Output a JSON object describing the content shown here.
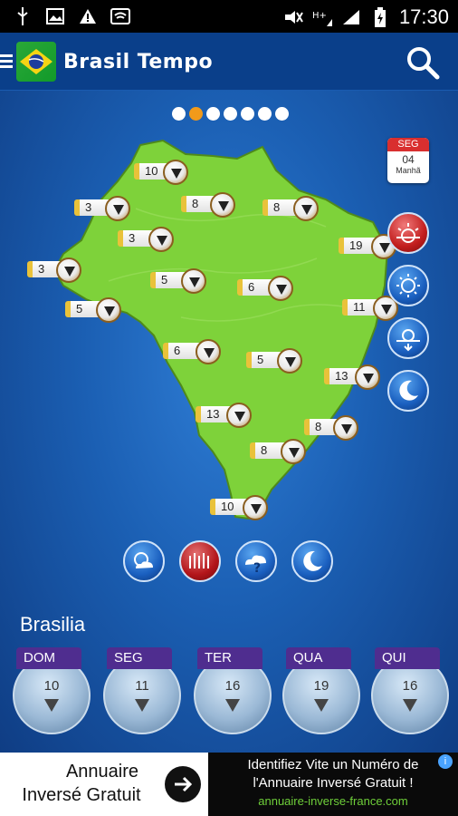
{
  "status_bar": {
    "time": "17:30",
    "icons": [
      "usb-icon",
      "image-icon",
      "warning-icon",
      "wifi-icon",
      "mute-icon",
      "hplus-signal-icon",
      "signal-icon",
      "battery-icon"
    ]
  },
  "app_bar": {
    "title": "Brasil Tempo",
    "icons": [
      "menu-icon",
      "brazil-flag-logo",
      "search-icon"
    ]
  },
  "pager": {
    "total": 7,
    "active_index": 1
  },
  "calendar": {
    "weekday": "SEG",
    "day": "04",
    "period": "Manhã"
  },
  "map_markers": [
    "10",
    "3",
    "8",
    "8",
    "3",
    "3",
    "19",
    "5",
    "6",
    "5",
    "11",
    "6",
    "5",
    "13",
    "13",
    "8",
    "8",
    "10"
  ],
  "period_buttons": [
    "sunrise-icon",
    "sun-icon",
    "sunset-icon",
    "moon-icon"
  ],
  "layer_buttons": [
    "cloud-icon",
    "thermometer-icon",
    "weather-help-icon",
    "night-icon"
  ],
  "city": "Brasilia",
  "forecast": [
    {
      "day": "DOM",
      "temp": "10"
    },
    {
      "day": "SEG",
      "temp": "11"
    },
    {
      "day": "TER",
      "temp": "16"
    },
    {
      "day": "QUA",
      "temp": "19"
    },
    {
      "day": "QUI",
      "temp": "16"
    }
  ],
  "ad": {
    "left_line1": "Annuaire",
    "left_line2": "Inversé Gratuit",
    "right_line1": "Identifiez Vite un Numéro de",
    "right_line2": "l'Annuaire Inversé Gratuit !",
    "url": "annuaire-inverse-france.com",
    "info": "i"
  },
  "colors": {
    "accent": "#f29a1a",
    "app_bar": "#0a3f8a",
    "map_green": "#7ed23a",
    "forecast_label": "#4f2d8f"
  }
}
